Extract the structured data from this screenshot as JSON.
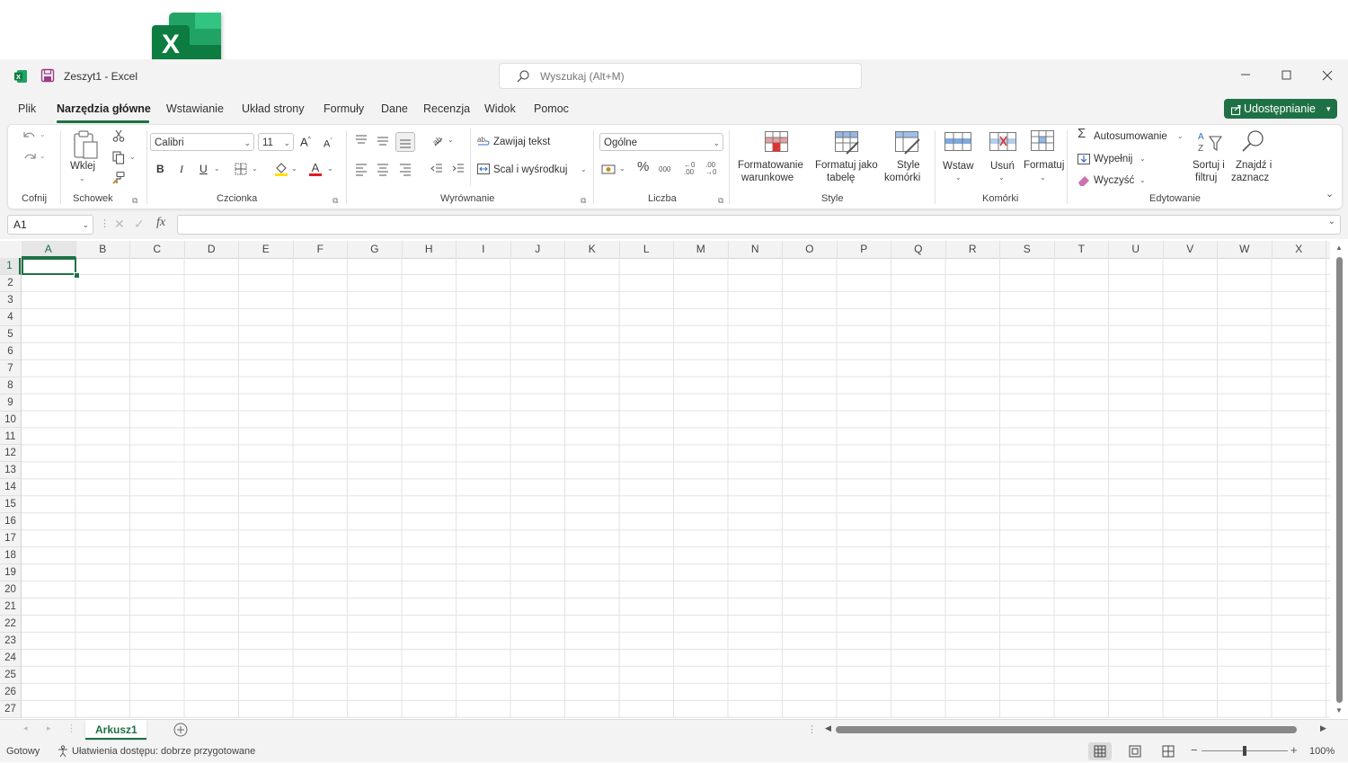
{
  "window": {
    "title": "Zeszyt1  -  Excel",
    "search_placeholder": "Wyszukaj (Alt+M)"
  },
  "menu": {
    "tabs": [
      "Plik",
      "Narzędzia główne",
      "Wstawianie",
      "Układ strony",
      "Formuły",
      "Dane",
      "Recenzja",
      "Widok",
      "Pomoc"
    ],
    "active_tab": "Narzędzia główne",
    "share_label": "Udostępnianie"
  },
  "ribbon": {
    "undo": {
      "group": "Cofnij"
    },
    "clipboard": {
      "paste": "Wklej",
      "group": "Schowek"
    },
    "font": {
      "name": "Calibri",
      "size": "11",
      "bold": "B",
      "italic": "I",
      "underline": "U",
      "group": "Czcionka"
    },
    "alignment": {
      "wrap": "Zawijaj tekst",
      "merge": "Scal i wyśrodkuj",
      "group": "Wyrównanie"
    },
    "number": {
      "format": "Ogólne",
      "group": "Liczba"
    },
    "styles": {
      "conditional_l1": "Formatowanie",
      "conditional_l2": "warunkowe",
      "table_l1": "Formatuj jako",
      "table_l2": "tabelę",
      "cell_l1": "Style",
      "cell_l2": "komórki",
      "group": "Style"
    },
    "cells": {
      "insert": "Wstaw",
      "delete": "Usuń",
      "format": "Formatuj",
      "group": "Komórki"
    },
    "editing": {
      "autosum": "Autosumowanie",
      "fill": "Wypełnij",
      "clear": "Wyczyść",
      "sort_l1": "Sortuj i",
      "sort_l2": "filtruj",
      "find_l1": "Znajdź i",
      "find_l2": "zaznacz",
      "group": "Edytowanie"
    }
  },
  "formula_bar": {
    "name_box": "A1",
    "fx": "fx"
  },
  "grid": {
    "columns": [
      "A",
      "B",
      "C",
      "D",
      "E",
      "F",
      "G",
      "H",
      "I",
      "J",
      "K",
      "L",
      "M",
      "N",
      "O",
      "P",
      "Q",
      "R",
      "S",
      "T",
      "U",
      "V",
      "W",
      "X"
    ],
    "rows": [
      "1",
      "2",
      "3",
      "4",
      "5",
      "6",
      "7",
      "8",
      "9",
      "10",
      "11",
      "12",
      "13",
      "14",
      "15",
      "16",
      "17",
      "18",
      "19",
      "20",
      "21",
      "22",
      "23",
      "24",
      "25",
      "26",
      "27"
    ]
  },
  "sheets": {
    "tabs": [
      "Arkusz1"
    ]
  },
  "status": {
    "ready": "Gotowy",
    "accessibility": "Ułatwienia dostępu: dobrze przygotowane",
    "zoom": "100%"
  },
  "colors": {
    "excel_green": "#1e7145",
    "chrome_bg": "#f3f3f3"
  }
}
